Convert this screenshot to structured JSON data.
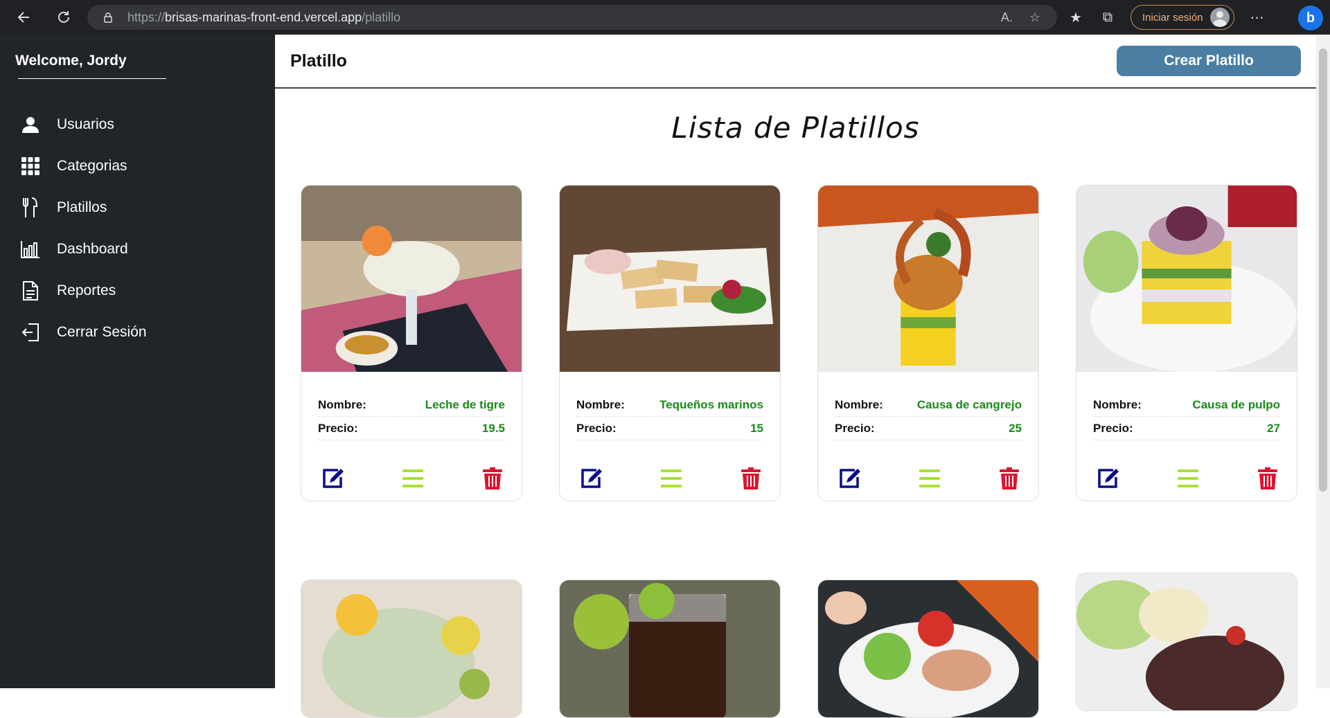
{
  "browser": {
    "url_proto": "https://",
    "url_host": "brisas-marinas-front-end.vercel.app",
    "url_path": "/platillo",
    "signin_label": "Iniciar sesión"
  },
  "sidebar": {
    "welcome": "Welcome, Jordy",
    "items": [
      {
        "label": "Usuarios",
        "icon": "user-icon"
      },
      {
        "label": "Categorias",
        "icon": "grid-icon"
      },
      {
        "label": "Platillos",
        "icon": "utensils-icon"
      },
      {
        "label": "Dashboard",
        "icon": "bar-chart-icon"
      },
      {
        "label": "Reportes",
        "icon": "document-icon"
      },
      {
        "label": "Cerrar Sesión",
        "icon": "logout-icon"
      }
    ]
  },
  "header": {
    "title": "Platillo",
    "create_button": "Crear Platillo"
  },
  "list_title": "Lista de Platillos",
  "labels": {
    "name": "Nombre:",
    "price": "Precio:"
  },
  "dishes": [
    {
      "name": "Leche de tigre",
      "price": "19.5"
    },
    {
      "name": "Tequeños marinos",
      "price": "15"
    },
    {
      "name": "Causa de cangrejo",
      "price": "25"
    },
    {
      "name": "Causa de pulpo",
      "price": "27"
    }
  ],
  "colors": {
    "sidebar_bg": "#212529",
    "accent_button": "#4a7ea3",
    "value_green": "#1a8a1a",
    "edit_icon": "#0b0b8a",
    "menu_icon": "#a6e22e",
    "delete_icon": "#e0122e"
  }
}
